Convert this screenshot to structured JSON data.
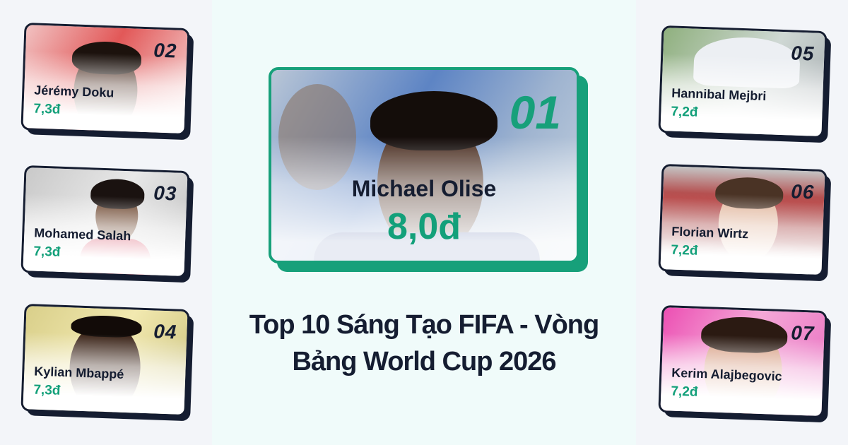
{
  "title": "Top 10 Sáng Tạo FIFA - Vòng Bảng World Cup 2026",
  "featured": {
    "rank": "01",
    "name": "Michael Olise",
    "score": "8,0đ"
  },
  "players": [
    {
      "rank": "02",
      "name": "Jérémy Doku",
      "score": "7,3đ"
    },
    {
      "rank": "03",
      "name": "Mohamed Salah",
      "score": "7,3đ"
    },
    {
      "rank": "04",
      "name": "Kylian Mbappé",
      "score": "7,3đ"
    },
    {
      "rank": "05",
      "name": "Hannibal Mejbri",
      "score": "7,2đ"
    },
    {
      "rank": "06",
      "name": "Florian Wirtz",
      "score": "7,2đ"
    },
    {
      "rank": "07",
      "name": "Kerim Alajbegovic",
      "score": "7,2đ"
    }
  ],
  "colors": {
    "accent": "#13a07a",
    "dark": "#151d31"
  }
}
